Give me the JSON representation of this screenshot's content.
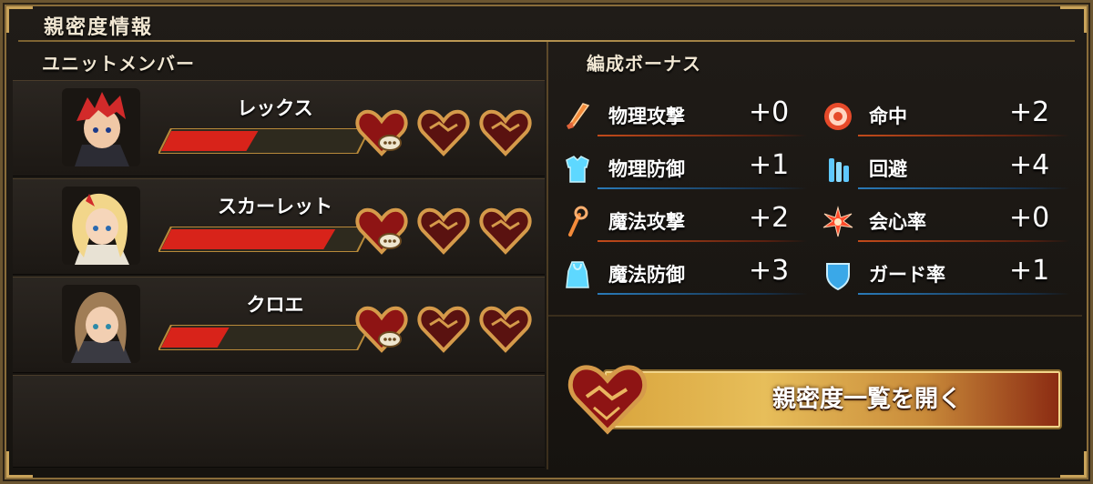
{
  "header": {
    "title": "親密度情報"
  },
  "members": {
    "heading": "ユニットメンバー",
    "list": [
      {
        "name": "レックス",
        "affinity": 0.45,
        "hearts_filled": 1
      },
      {
        "name": "スカーレット",
        "affinity": 0.85,
        "hearts_filled": 1
      },
      {
        "name": "クロエ",
        "affinity": 0.3,
        "hearts_filled": 1
      }
    ]
  },
  "bonus": {
    "heading": "編成ボーナス",
    "stats": [
      {
        "label": "物理攻撃",
        "value": "+0",
        "icon": "sword-icon"
      },
      {
        "label": "命中",
        "value": "+2",
        "icon": "target-icon"
      },
      {
        "label": "物理防御",
        "value": "+1",
        "icon": "armor-icon"
      },
      {
        "label": "回避",
        "value": "+4",
        "icon": "evade-icon"
      },
      {
        "label": "魔法攻撃",
        "value": "+2",
        "icon": "staff-icon"
      },
      {
        "label": "会心率",
        "value": "+0",
        "icon": "critical-icon"
      },
      {
        "label": "魔法防御",
        "value": "+3",
        "icon": "robe-icon"
      },
      {
        "label": "ガード率",
        "value": "+1",
        "icon": "shield-icon"
      }
    ],
    "open_button": "親密度一覧を開く"
  },
  "colors": {
    "accent_gold": "#c9a35a",
    "bar_red": "#d8231a",
    "heart_red": "#8e1414"
  }
}
